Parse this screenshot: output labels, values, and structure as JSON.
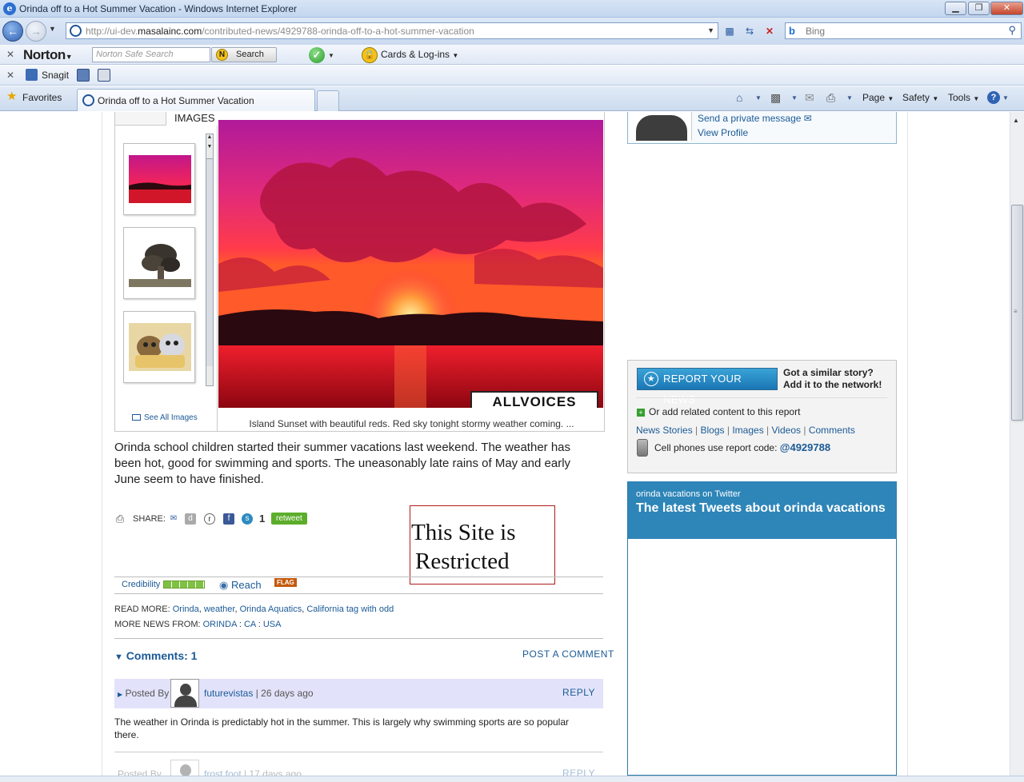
{
  "window": {
    "title": "Orinda off to a Hot Summer Vacation - Windows Internet Explorer",
    "min": "▁",
    "max": "❐",
    "close": "✕"
  },
  "address": {
    "url_pre": "http://ui-dev.",
    "url_host": "masalainc.com",
    "url_post": "/contributed-news/4929788-orinda-off-to-a-hot-summer-vacation",
    "search_provider": "Bing"
  },
  "norton": {
    "logo": "Norton",
    "search_placeholder": "Norton Safe Search",
    "search_button": "Search",
    "cards_label": "Cards & Log-ins"
  },
  "links_toolbar": {
    "snagit": "Snagit"
  },
  "tabs": {
    "favorites": "Favorites",
    "active_tab": "Orinda off to a Hot Summer Vacation",
    "commands": {
      "page": "Page",
      "safety": "Safety",
      "tools": "Tools"
    }
  },
  "gallery": {
    "images_label": "IMAGES",
    "see_all": "See All Images",
    "brand": "ALLVOICES",
    "caption": "Island Sunset with beautiful reds.  Red sky tonight stormy weather coming. ..."
  },
  "article": {
    "body": "Orinda school children started their summer vacations last weekend. The weather has been hot, good for swimming and sports. The uneasonably late rains of May and early June seem to have finished.",
    "share_label": "SHARE:",
    "retweet_count": "1",
    "retweet_label": "retweet",
    "restricted_line1": "This Site is",
    "restricted_line2": "Restricted",
    "credibility_label": "Credibility",
    "reach_label": "Reach",
    "flag_label": "FLAG",
    "read_more_label": "READ MORE:",
    "read_more_links": [
      "Orinda",
      "weather",
      "Orinda Aquatics",
      "California tag with odd"
    ],
    "more_news_label": "MORE NEWS FROM:",
    "more_news_links": [
      "ORINDA",
      "CA",
      "USA"
    ]
  },
  "comments": {
    "title": "Comments:  1",
    "post_label": "POST A COMMENT",
    "items": [
      {
        "posted_by": "Posted By",
        "user": "futurevistas",
        "age": "26 days ago",
        "reply": "REPLY",
        "text": "The weather in Orinda is predictably hot in the summer. This is largely why swimming sports are so popular there."
      },
      {
        "posted_by": "Posted By",
        "user": "frost foot",
        "age": "17 days ago",
        "reply": "REPLY"
      }
    ]
  },
  "sidebar": {
    "profile": {
      "send_message": "Send a private message",
      "view_profile": "View Profile"
    },
    "report": {
      "button": "REPORT YOUR NEWS",
      "similar_line1": "Got a similar story?",
      "similar_line2": "Add it to the network!",
      "related": "Or add related content to this report",
      "links": [
        "News Stories",
        "Blogs",
        "Images",
        "Videos",
        "Comments"
      ],
      "cell_label": "Cell phones use report code:",
      "cell_code": "@4929788"
    },
    "twitter": {
      "sub": "orinda vacations on Twitter",
      "title": "The latest Tweets about orinda vacations"
    }
  },
  "colors": {
    "link": "#1b5a96",
    "twitter_header": "#2e85b8",
    "comment_bg": "#e2e3fa",
    "restricted_border": "#b01c1c"
  }
}
